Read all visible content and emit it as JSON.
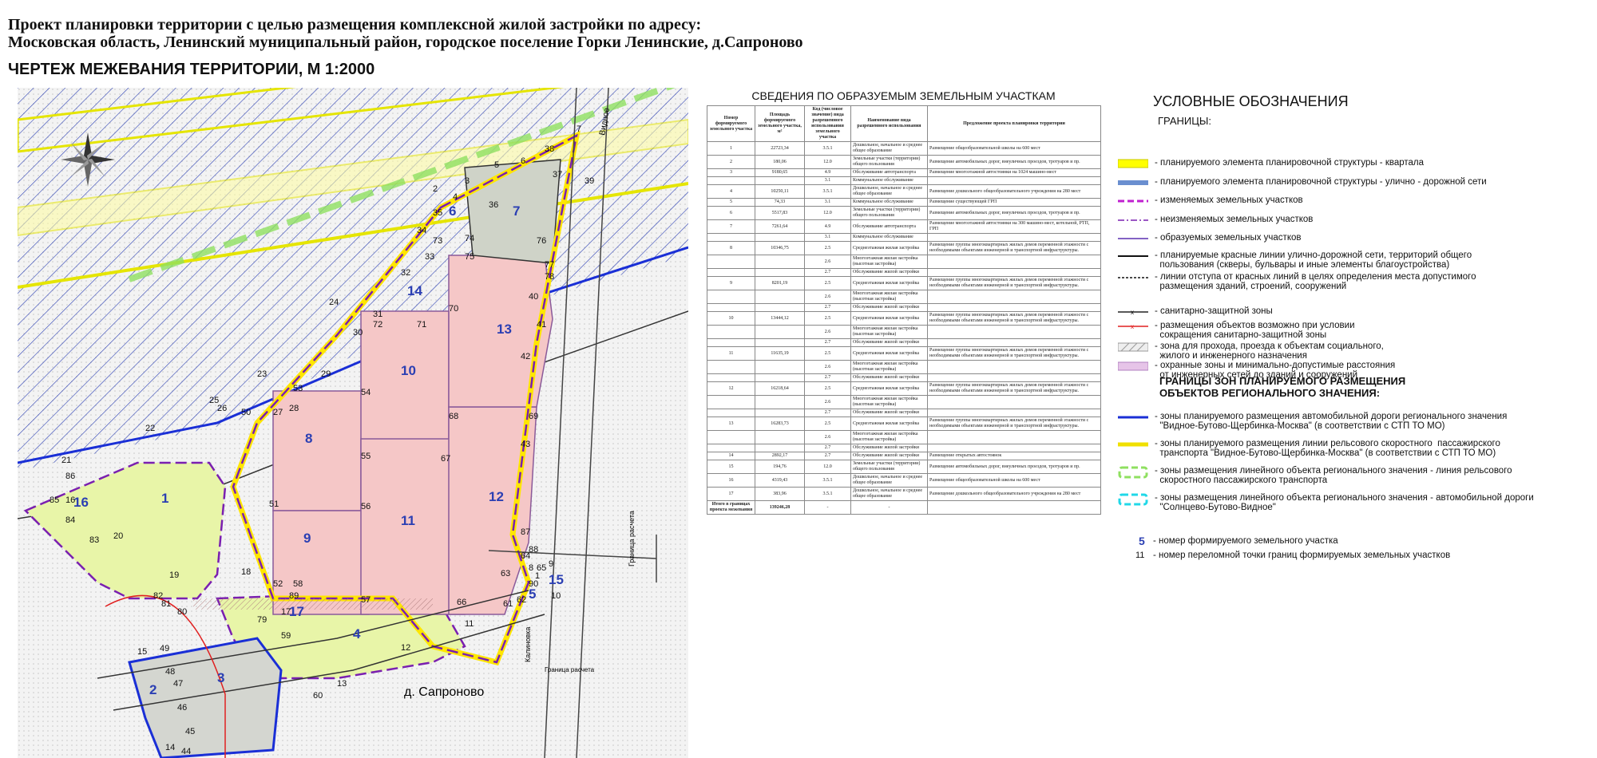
{
  "header": {
    "title_line1": "Проект планировки территории с целью размещения комплексной жилой застройки по адресу:",
    "title_line2": "Московская область, Ленинский муниципальный район, городское поселение  Горки Ленинские, д.Сапроново",
    "subtitle": "ЧЕРТЕЖ МЕЖЕВАНИЯ ТЕРРИТОРИИ, М 1:2000"
  },
  "map": {
    "place_label": "д. Сапроново",
    "road_label_top": "Видное",
    "road_label_right": "Граница расчета",
    "road_label_bottom": "Граница расчета",
    "street_label": "Калиновка",
    "parcels": [
      {
        "n": "1"
      },
      {
        "n": "2"
      },
      {
        "n": "3"
      },
      {
        "n": "4"
      },
      {
        "n": "5"
      },
      {
        "n": "6"
      },
      {
        "n": "7"
      },
      {
        "n": "8"
      },
      {
        "n": "9"
      },
      {
        "n": "10"
      },
      {
        "n": "11"
      },
      {
        "n": "12"
      },
      {
        "n": "13"
      },
      {
        "n": "14"
      },
      {
        "n": "15"
      },
      {
        "n": "16"
      },
      {
        "n": "17"
      }
    ],
    "points": [
      "1",
      "2",
      "3",
      "4",
      "5",
      "6",
      "7",
      "8",
      "9",
      "10",
      "11",
      "12",
      "13",
      "14",
      "15",
      "16",
      "17",
      "18",
      "19",
      "20",
      "21",
      "22",
      "23",
      "24",
      "25",
      "26",
      "27",
      "28",
      "29",
      "30",
      "31",
      "32",
      "33",
      "34",
      "35",
      "36",
      "37",
      "38",
      "39",
      "40",
      "41",
      "42",
      "43",
      "44",
      "45",
      "46",
      "47",
      "48",
      "49",
      "50",
      "51",
      "52",
      "53",
      "54",
      "55",
      "56",
      "57",
      "58",
      "59",
      "60",
      "61",
      "62",
      "63",
      "64",
      "65",
      "66",
      "67",
      "68",
      "69",
      "70",
      "71",
      "72",
      "73",
      "74",
      "75",
      "76",
      "77",
      "78",
      "79",
      "80",
      "81",
      "82",
      "83",
      "84",
      "85",
      "86",
      "87",
      "88",
      "89",
      "90"
    ],
    "colors": {
      "quarter": "#ffff00",
      "residential": "#f5c7c7",
      "green": "#e8f5a8",
      "school": "#d6d6d6",
      "hatch": "#2b3fb3",
      "boundary": "#7a1fb0",
      "road_blue": "#1a2fd6"
    }
  },
  "table": {
    "title": "СВЕДЕНИЯ ПО ОБРАЗУЕМЫМ ЗЕМЕЛЬНЫМ УЧАСТКАМ",
    "headers": [
      "Номер формируемого земельного участка",
      "Площадь формируемого земельного участка, м²",
      "Код (числовое значение) вида разрешенного использования земельного участка",
      "Наименование вида разрешенного использования",
      "Предложение проекта планировки территории"
    ],
    "rows": [
      {
        "n": "1",
        "area": "22723,34",
        "code": "3.5.1",
        "name": "Дошкольное, начальное и среднее общее образование",
        "prop": "Размещение общеобразовательной школы на 600 мест"
      },
      {
        "n": "2",
        "area": "180,06",
        "code": "12.0",
        "name": "Земельные участки (территории) общего пользования",
        "prop": "Размещение автомобильных дорог, внеуличных проездов, тротуаров и пр."
      },
      {
        "n": "3",
        "area": "9180,65",
        "code": "4.9",
        "name": "Обслуживание автотранспорта",
        "prop": "Размещение многоэтажной автостоянки на 1024 машино-мест"
      },
      {
        "n": "",
        "area": "",
        "code": "3.1",
        "name": "Коммунальное обслуживание",
        "prop": ""
      },
      {
        "n": "4",
        "area": "10250,11",
        "code": "3.5.1",
        "name": "Дошкольное, начальное и среднее общее образование",
        "prop": "Размещение дошкольного общеобразовательного учреждения на 280 мест"
      },
      {
        "n": "5",
        "area": "74,33",
        "code": "3.1",
        "name": "Коммунальное обслуживание",
        "prop": "Размещение существующей ГРП"
      },
      {
        "n": "6",
        "area": "5517,83",
        "code": "12.0",
        "name": "Земельные участки (территории) общего пользования",
        "prop": "Размещение автомобильных дорог, внеуличных проездов, тротуаров и пр."
      },
      {
        "n": "7",
        "area": "7261,64",
        "code": "4.9",
        "name": "Обслуживание автотранспорта",
        "prop": "Размещение многоэтажной автостоянки на 300 машино-мест, котельной, РТП, ГРП"
      },
      {
        "n": "",
        "area": "",
        "code": "3.1",
        "name": "Коммунальное обслуживание",
        "prop": ""
      },
      {
        "n": "8",
        "area": "10346,75",
        "code": "2.5",
        "name": "Среднеэтажная жилая застройка",
        "prop": "Размещение группы многоквартирных жилых домов переменной этажности с необходимыми объектами инженерной и транспортной инфраструктуры."
      },
      {
        "n": "",
        "area": "",
        "code": "2.6",
        "name": "Многоэтажная жилая застройка (высотная застройка)",
        "prop": ""
      },
      {
        "n": "",
        "area": "",
        "code": "2.7",
        "name": "Обслуживание жилой застройки",
        "prop": ""
      },
      {
        "n": "9",
        "area": "8201,19",
        "code": "2.5",
        "name": "Среднеэтажная жилая застройка",
        "prop": "Размещение группы многоквартирных жилых домов переменной этажности с необходимыми объектами инженерной и транспортной инфраструктуры."
      },
      {
        "n": "",
        "area": "",
        "code": "2.6",
        "name": "Многоэтажная жилая застройка (высотная застройка)",
        "prop": ""
      },
      {
        "n": "",
        "area": "",
        "code": "2.7",
        "name": "Обслуживание жилой застройки",
        "prop": ""
      },
      {
        "n": "10",
        "area": "13444,12",
        "code": "2.5",
        "name": "Среднеэтажная жилая застройка",
        "prop": "Размещение группы многоквартирных жилых домов переменной этажности с необходимыми объектами инженерной и транспортной инфраструктуры."
      },
      {
        "n": "",
        "area": "",
        "code": "2.6",
        "name": "Многоэтажная жилая застройка (высотная застройка)",
        "prop": ""
      },
      {
        "n": "",
        "area": "",
        "code": "2.7",
        "name": "Обслуживание жилой застройки",
        "prop": ""
      },
      {
        "n": "11",
        "area": "11635,19",
        "code": "2.5",
        "name": "Среднеэтажная жилая застройка",
        "prop": "Размещение группы многоквартирных жилых домов переменной этажности с необходимыми объектами инженерной и транспортной инфраструктуры."
      },
      {
        "n": "",
        "area": "",
        "code": "2.6",
        "name": "Многоэтажная жилая застройка (высотная застройка)",
        "prop": ""
      },
      {
        "n": "",
        "area": "",
        "code": "2.7",
        "name": "Обслуживание жилой застройки",
        "prop": ""
      },
      {
        "n": "12",
        "area": "16218,64",
        "code": "2.5",
        "name": "Среднеэтажная жилая застройка",
        "prop": "Размещение группы многоквартирных жилых домов переменной этажности с необходимыми объектами инженерной и транспортной инфраструктуры."
      },
      {
        "n": "",
        "area": "",
        "code": "2.6",
        "name": "Многоэтажная жилая застройка (высотная застройка)",
        "prop": ""
      },
      {
        "n": "",
        "area": "",
        "code": "2.7",
        "name": "Обслуживание жилой застройки",
        "prop": ""
      },
      {
        "n": "13",
        "area": "16283,73",
        "code": "2.5",
        "name": "Среднеэтажная жилая застройка",
        "prop": "Размещение группы многоквартирных жилых домов переменной этажности с необходимыми объектами инженерной и транспортной инфраструктуры."
      },
      {
        "n": "",
        "area": "",
        "code": "2.6",
        "name": "Многоэтажная жилая застройка (высотная застройка)",
        "prop": ""
      },
      {
        "n": "",
        "area": "",
        "code": "2.7",
        "name": "Обслуживание жилой застройки",
        "prop": ""
      },
      {
        "n": "14",
        "area": "2892,17",
        "code": "2.7",
        "name": "Обслуживание жилой застройки",
        "prop": "Размещение открытых автостоянок"
      },
      {
        "n": "15",
        "area": "194,76",
        "code": "12.0",
        "name": "Земельные участки (территории) общего пользования",
        "prop": "Размещение автомобильных дорог, внеуличных проездов, тротуаров и пр."
      },
      {
        "n": "16",
        "area": "4319,43",
        "code": "3.5.1",
        "name": "Дошкольное, начальное и среднее общее образование",
        "prop": "Размещение общеобразовательной школы на 600 мест"
      },
      {
        "n": "17",
        "area": "383,96",
        "code": "3.5.1",
        "name": "Дошкольное, начальное и среднее общее образование",
        "prop": "Размещение дошкольного общеобразовательного учреждения на 280 мест"
      }
    ],
    "total_label": "Итого в границах проекта межевания",
    "total_area": "139246,28",
    "total_code": "-",
    "total_name": "-"
  },
  "legend": {
    "title": "УСЛОВНЫЕ ОБОЗНАЧЕНИЯ",
    "boundaries_label": "ГРАНИЦЫ:",
    "items": [
      "- планируемого элемента планировочной структуры - квартала",
      "- планируемого элемента планировочной структуры - улично - дорожной сети",
      "- изменяемых земельных участков",
      "- неизменяемых земельных участков",
      "- образуемых земельных участков",
      "- планируемые красные линии улично-дорожной сети, территорий общего\n  пользования (скверы, бульвары и иные элементы благоустройства)",
      "- линии отступа от красных линий в целях определения места допустимого\n  размещения зданий, строений, сооружений",
      "- санитарно-защитной зоны",
      "- размещения объектов возможно при условии\n  сокращения санитарно-защитной зоны",
      "- зона для прохода, проезда к объектам социального,\n  жилого и инженерного назначения",
      "- охранные зоны и минимально-допустимые расстояния\n  от инженерных сетей до зданий и сооружений"
    ],
    "regional_title_line1": "ГРАНИЦЫ ЗОН ПЛАНИРУЕМОГО РАЗМЕЩЕНИЯ",
    "regional_title_line2": "ОБЪЕКТОВ РЕГИОНАЛЬНОГО ЗНАЧЕНИЯ:",
    "regional_items": [
      "- зоны планируемого размещения автомобильной дороги регионального значения\n  \"Видное-Бутово-Щербинка-Москва\" (в соответствии с СТП ТО МО)",
      "- зоны планируемого размещения линии рельсового скоростного  пассажирского\n  транспорта \"Видное-Бутово-Щербинка-Москва\" (в соответствии с СТП ТО МО)",
      "- зоны размещения линейного объекта регионального значения - линия рельсового\n  скоростного пассажирского транспорта",
      "- зоны размещения линейного объекта регионального значения - автомобильной дороги\n  \"Солнцево-Бутово-Видное\""
    ],
    "numbering": [
      {
        "sample": "5",
        "text": "- номер формируемого земельного участка"
      },
      {
        "sample": "11",
        "text": "- номер переломной точки границ формируемых земельных участков"
      }
    ]
  }
}
